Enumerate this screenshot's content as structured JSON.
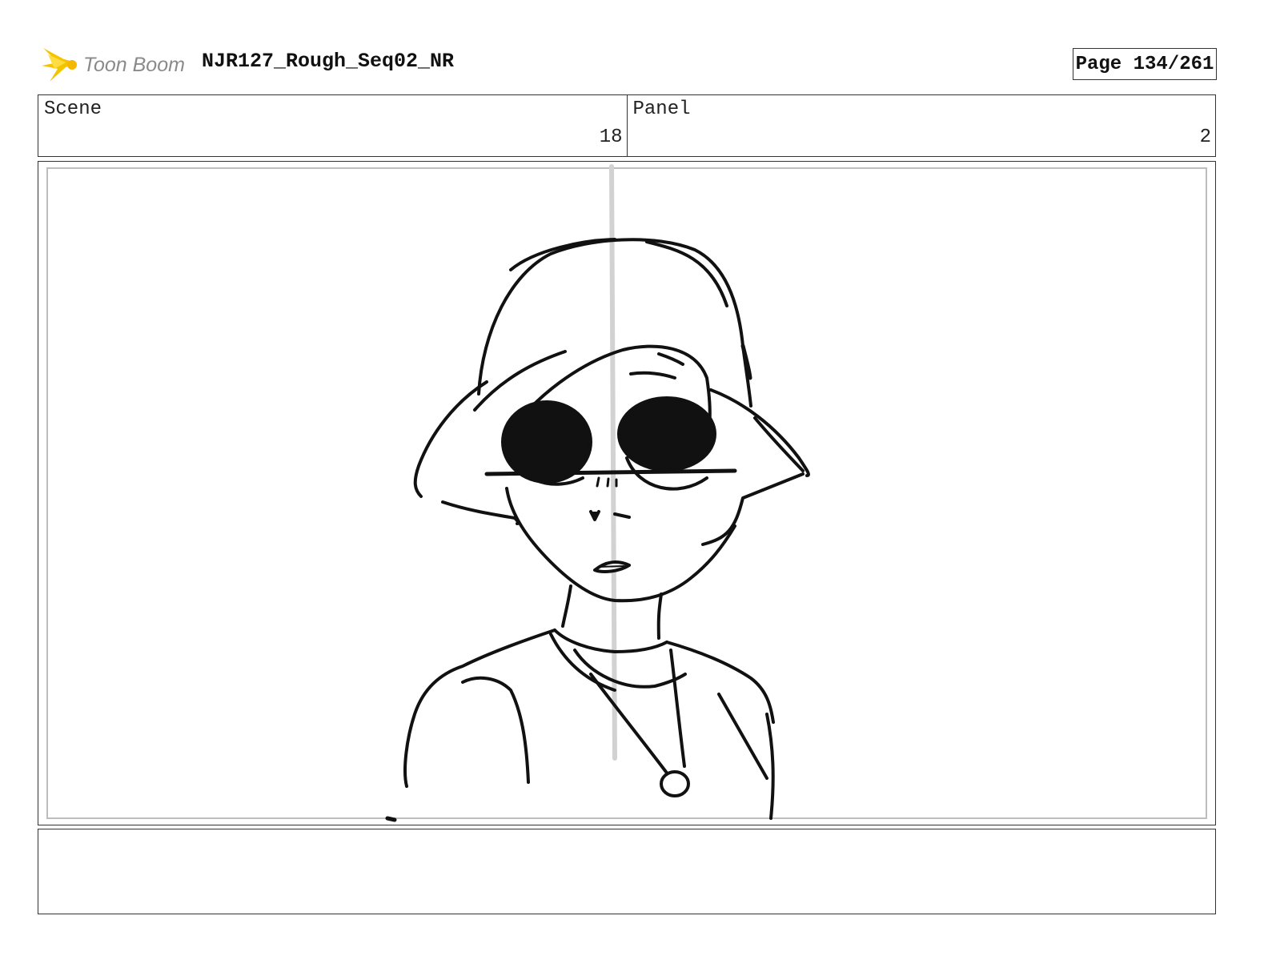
{
  "header": {
    "logo_text": "Toon Boom",
    "title": "NJR127_Rough_Seq02_NR",
    "page_label": "Page 134/261"
  },
  "info": {
    "scene_label": "Scene",
    "scene_value": "18",
    "panel_label": "Panel",
    "panel_value": "2"
  },
  "colors": {
    "logo_star": "#f5c400",
    "logo_text": "#8a8a8a",
    "border": "#333333",
    "guide_line": "#cfcfcf"
  },
  "icons": {
    "logo": "toon-boom-star-icon"
  },
  "notes": {
    "text": ""
  }
}
